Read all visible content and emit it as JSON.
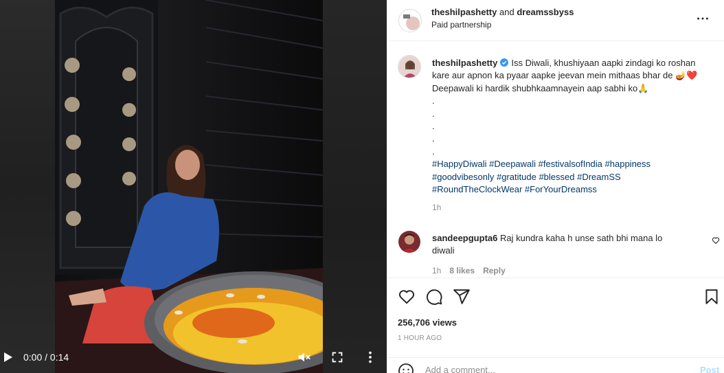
{
  "video": {
    "time_display": "0:00 / 0:14",
    "icons": {
      "play": "play-icon",
      "mute": "volume-muted-icon",
      "fullscreen": "fullscreen-icon",
      "more": "more-vertical-icon"
    }
  },
  "header": {
    "author": "theshilpashetty",
    "and_text": "and",
    "partner": "dreamssbyss",
    "subtitle": "Paid partnership",
    "more_icon": "more-horizontal-icon"
  },
  "caption": {
    "author": "theshilpashetty",
    "verified": true,
    "text": "Iss Diwali, khushiyaan aapki zindagi ko roshan kare aur apnon ka pyaar aapke jeevan mein mithaas bhar de 🪔❤️ Deepawali ki hardik shubhkaamnayein aap sabhi ko🙏",
    "dots": [
      ".",
      ".",
      ".",
      ".",
      "."
    ],
    "hashtags": [
      "#HappyDiwali",
      "#Deepawali",
      "#festivalsofIndia",
      "#happiness",
      "#goodvibesonly",
      "#gratitude",
      "#blessed",
      "#DreamSS",
      "#RoundTheClockWear",
      "#ForYourDreamss"
    ],
    "time": "1h"
  },
  "comment": {
    "author": "sandeepgupta6",
    "text": "Raj kundra kaha h unse sath bhi mana lo diwali",
    "time": "1h",
    "likes": "8 likes",
    "reply": "Reply"
  },
  "actions": {
    "icons": [
      "heart-icon",
      "comment-icon",
      "share-icon",
      "bookmark-icon"
    ],
    "views": "256,706 views",
    "posted": "1 HOUR AGO"
  },
  "add_comment": {
    "placeholder": "Add a comment...",
    "post_label": "Post"
  },
  "colors": {
    "link": "#00376b",
    "muted": "#8e8e8e",
    "verified": "#3897f0",
    "post_disabled": "#b2dffc"
  }
}
